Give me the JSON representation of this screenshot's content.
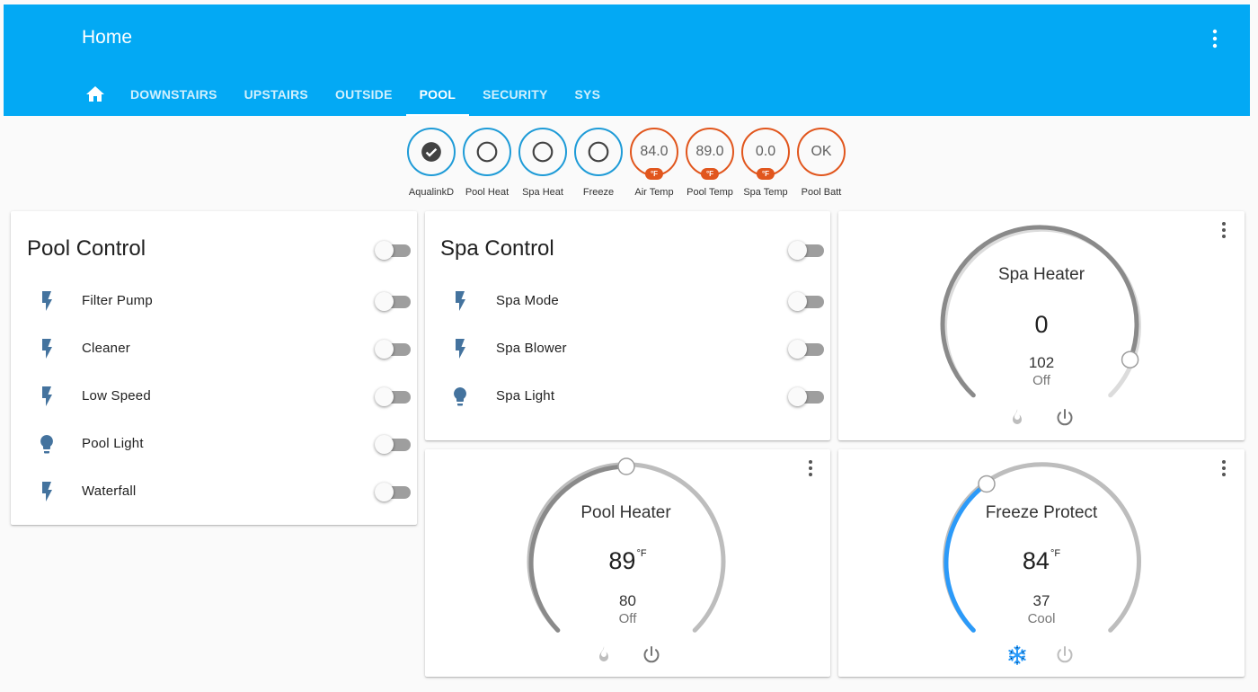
{
  "header": {
    "title": "Home",
    "tabs": [
      {
        "label": "DOWNSTAIRS"
      },
      {
        "label": "UPSTAIRS"
      },
      {
        "label": "OUTSIDE"
      },
      {
        "label": "POOL",
        "active": true
      },
      {
        "label": "SECURITY"
      },
      {
        "label": "SYS"
      }
    ]
  },
  "badges": [
    {
      "label": "AqualinkD",
      "state": "on",
      "icon": "check-icon"
    },
    {
      "label": "Pool Heat",
      "state": "off",
      "icon": "circle-icon"
    },
    {
      "label": "Spa Heat",
      "state": "off",
      "icon": "circle-icon"
    },
    {
      "label": "Freeze",
      "state": "off",
      "icon": "circle-icon"
    },
    {
      "label": "Air Temp",
      "value": "84.0",
      "unit": "°F"
    },
    {
      "label": "Pool Temp",
      "value": "89.0",
      "unit": "°F"
    },
    {
      "label": "Spa Temp",
      "value": "0.0",
      "unit": "°F"
    },
    {
      "label": "Pool Batt",
      "value": "OK"
    }
  ],
  "pool_control": {
    "title": "Pool Control",
    "items": [
      {
        "label": "Filter Pump",
        "icon": "flash-icon"
      },
      {
        "label": "Cleaner",
        "icon": "flash-icon"
      },
      {
        "label": "Low Speed",
        "icon": "flash-icon"
      },
      {
        "label": "Pool Light",
        "icon": "lightbulb-icon"
      },
      {
        "label": "Waterfall",
        "icon": "flash-icon"
      }
    ]
  },
  "spa_control": {
    "title": "Spa Control",
    "items": [
      {
        "label": "Spa Mode",
        "icon": "flash-icon"
      },
      {
        "label": "Spa Blower",
        "icon": "flash-icon"
      },
      {
        "label": "Spa Light",
        "icon": "lightbulb-icon"
      }
    ]
  },
  "thermostats": {
    "spa_heater": {
      "name": "Spa Heater",
      "current": "0",
      "unit": "",
      "target": "102",
      "mode": "Off"
    },
    "pool_heater": {
      "name": "Pool Heater",
      "current": "89",
      "unit": "°F",
      "target": "80",
      "mode": "Off"
    },
    "freeze_protect": {
      "name": "Freeze Protect",
      "current": "84",
      "unit": "°F",
      "target": "37",
      "mode": "Cool"
    }
  },
  "colors": {
    "header": "#03a9f4",
    "switch_badge": "#1e9bd7",
    "sensor_badge": "#e1561d",
    "entity_icon": "#44739e",
    "cool": "#2b9af9"
  }
}
